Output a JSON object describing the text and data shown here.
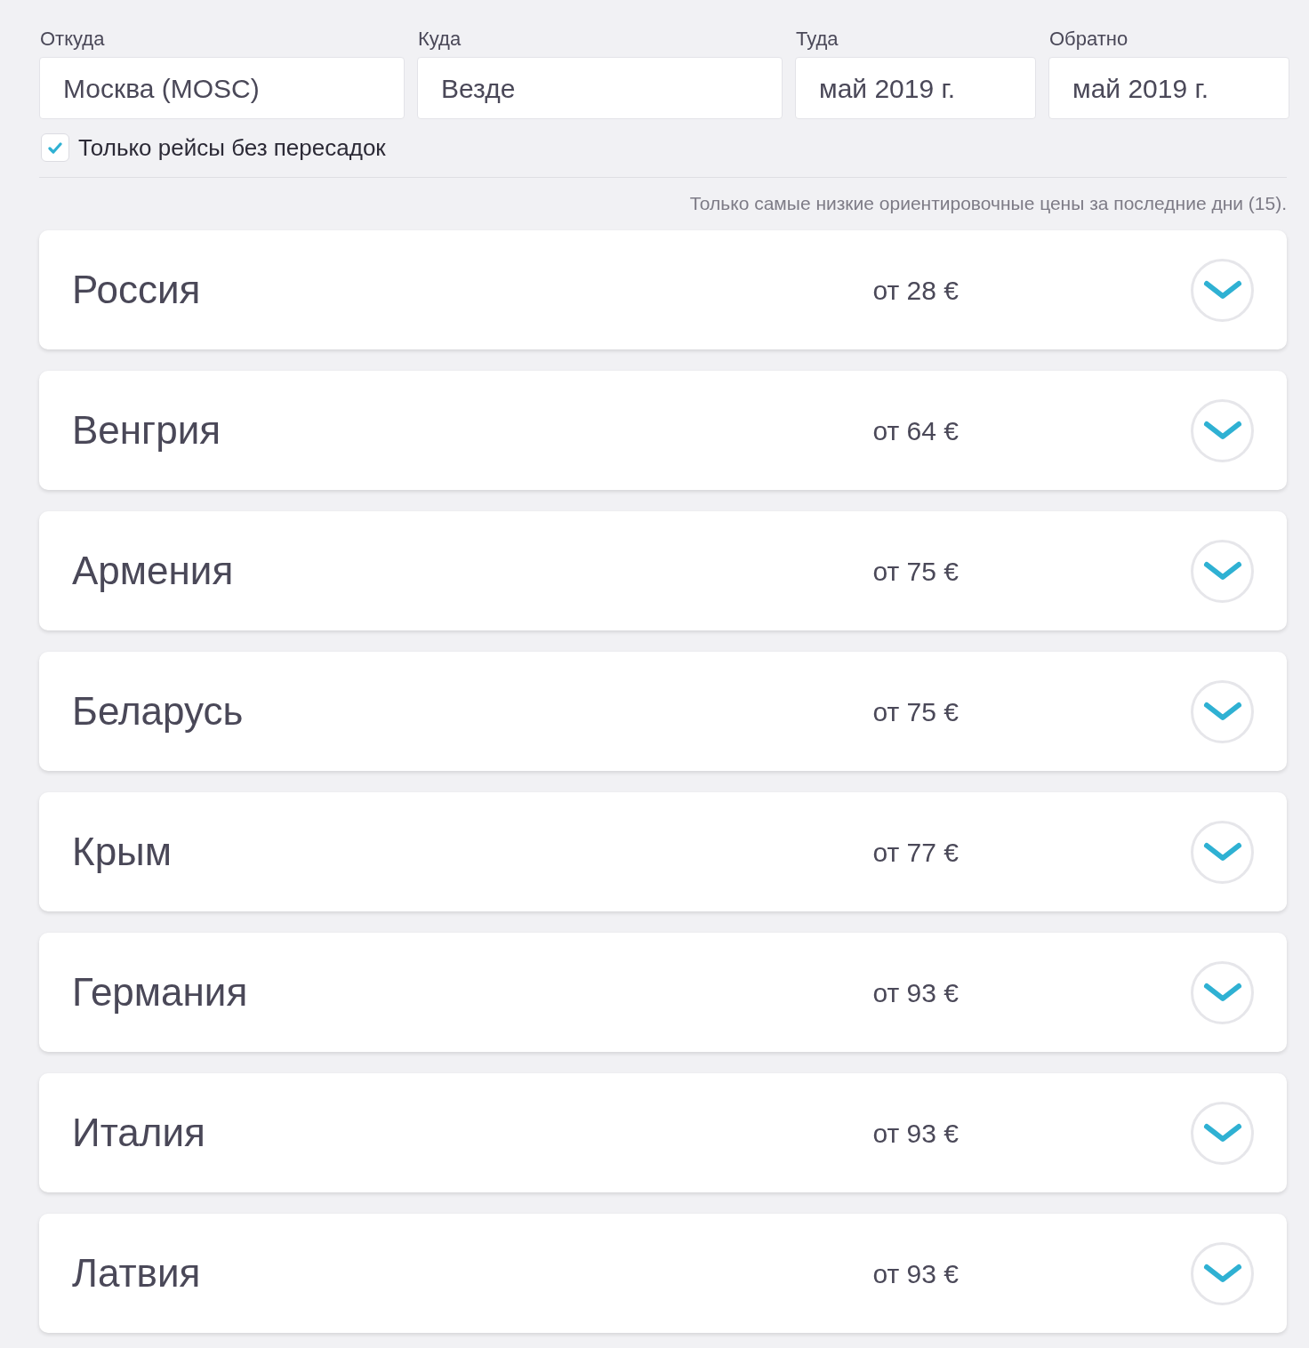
{
  "search": {
    "fields": [
      {
        "label": "Откуда",
        "value": "Москва (MOSC)"
      },
      {
        "label": "Куда",
        "value": "Везде"
      },
      {
        "label": "Туда",
        "value": "май 2019 г."
      },
      {
        "label": "Обратно",
        "value": "май 2019 г."
      }
    ],
    "direct_only": {
      "label": "Только рейсы без пересадок",
      "checked": true
    }
  },
  "note": "Только самые низкие ориентировочные цены за последние дни (15).",
  "destinations": [
    {
      "name": "Россия",
      "price": "от 28 €",
      "expanded": false
    },
    {
      "name": "Венгрия",
      "price": "от 64 €",
      "expanded": false
    },
    {
      "name": "Армения",
      "price": "от 75 €",
      "expanded": false
    },
    {
      "name": "Беларусь",
      "price": "от 75 €",
      "expanded": false
    },
    {
      "name": "Крым",
      "price": "от 77 €",
      "expanded": false
    },
    {
      "name": "Германия",
      "price": "от 93 €",
      "expanded": false
    },
    {
      "name": "Италия",
      "price": "от 93 €",
      "expanded": false
    },
    {
      "name": "Латвия",
      "price": "от 93 €",
      "expanded": false
    }
  ]
}
